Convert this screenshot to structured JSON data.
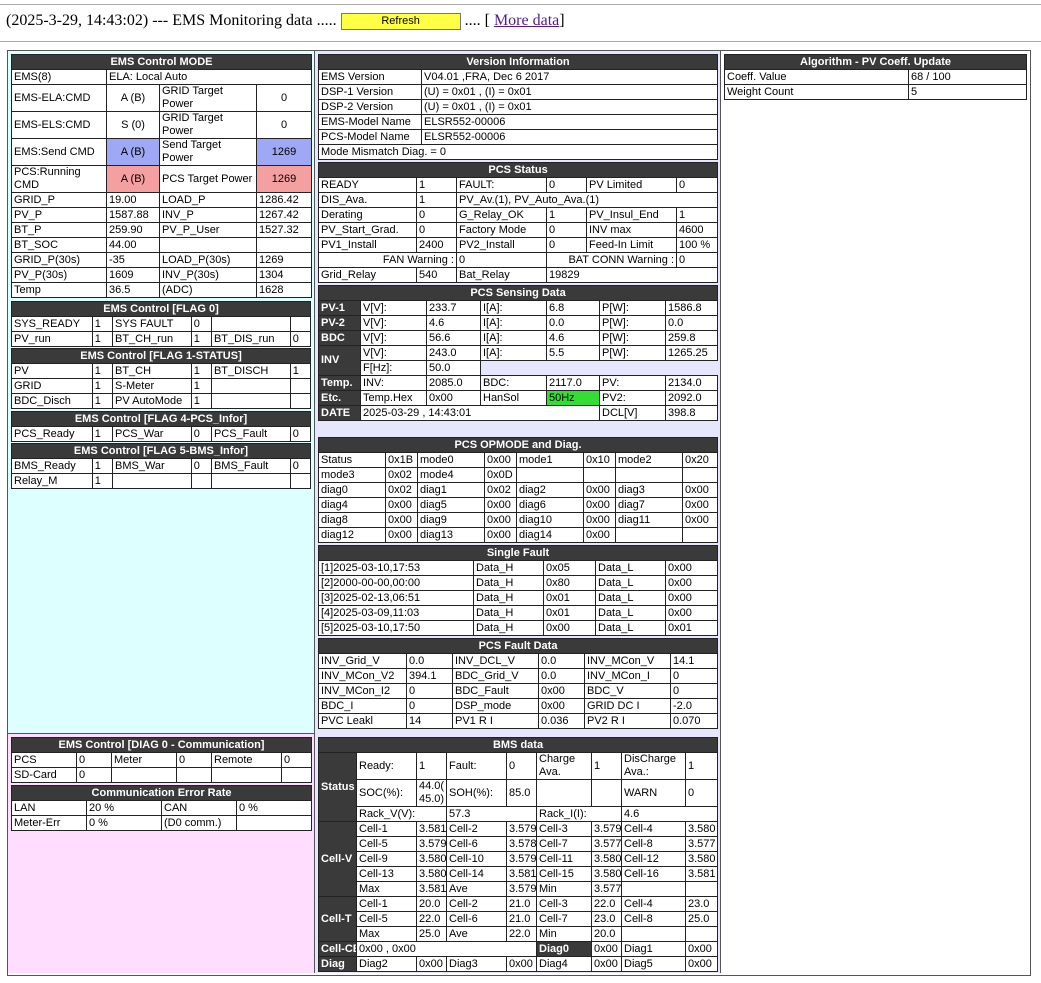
{
  "header": {
    "prefix": "(2025-3-29, 14:43:02) --- EMS Monitoring data .....",
    "refresh": "Refresh",
    "middle": ".... [",
    "more": "More data",
    "suffix": "]"
  },
  "ems_mode": {
    "title": "EMS Control MODE",
    "rows": [
      [
        "EMS(8)",
        "ELA: Local Auto"
      ],
      [
        "EMS-ELA:CMD",
        "A (B)",
        "GRID Target Power",
        "0"
      ],
      [
        "EMS-ELS:CMD",
        "S (0)",
        "GRID Target Power",
        "0"
      ],
      [
        "EMS:Send CMD",
        "A (B)",
        "Send Target Power",
        "1269"
      ],
      [
        "PCS:Running CMD",
        "A (B)",
        "PCS Target Power",
        "1269"
      ],
      [
        "GRID_P",
        "19.00",
        "LOAD_P",
        "1286.42"
      ],
      [
        "PV_P",
        "1587.88",
        "INV_P",
        "1267.42"
      ],
      [
        "BT_P",
        "259.90",
        "PV_P_User",
        "1527.32"
      ],
      [
        "BT_SOC",
        "44.00",
        "",
        ""
      ],
      [
        "GRID_P(30s)",
        "-35",
        "LOAD_P(30s)",
        "1269"
      ],
      [
        "PV_P(30s)",
        "1609",
        "INV_P(30s)",
        "1304"
      ],
      [
        "Temp",
        "36.5",
        "(ADC)",
        "1628"
      ]
    ]
  },
  "flag0": {
    "title": "EMS Control [FLAG 0]",
    "rows": [
      [
        "SYS_READY",
        "1",
        "SYS FAULT",
        "0",
        "",
        ""
      ],
      [
        "PV_run",
        "1",
        "BT_CH_run",
        "1",
        "BT_DIS_run",
        "0"
      ]
    ]
  },
  "flag1": {
    "title": "EMS Control [FLAG 1-STATUS]",
    "rows": [
      [
        "PV",
        "1",
        "BT_CH",
        "1",
        "BT_DISCH",
        "1"
      ],
      [
        "GRID",
        "1",
        "S-Meter",
        "1",
        "",
        ""
      ],
      [
        "BDC_Disch",
        "1",
        "PV AutoMode",
        "1",
        "",
        ""
      ]
    ]
  },
  "flag4": {
    "title": "EMS Control [FLAG 4-PCS_Infor]",
    "rows": [
      [
        "PCS_Ready",
        "1",
        "PCS_War",
        "0",
        "PCS_Fault",
        "0"
      ]
    ]
  },
  "flag5": {
    "title": "EMS Control [FLAG 5-BMS_Infor]",
    "rows": [
      [
        "BMS_Ready",
        "1",
        "BMS_War",
        "0",
        "BMS_Fault",
        "0"
      ],
      [
        "Relay_M",
        "1",
        "",
        "",
        "",
        ""
      ]
    ]
  },
  "diag0": {
    "title": "EMS Control [DIAG 0 - Communication]",
    "rows": [
      [
        "PCS",
        "0",
        "Meter",
        "0",
        "Remote",
        "0"
      ],
      [
        "SD-Card",
        "0",
        "",
        "",
        "",
        ""
      ]
    ]
  },
  "comm": {
    "title": "Communication Error Rate",
    "rows": [
      [
        "LAN",
        "20 %",
        "CAN",
        "0 %"
      ],
      [
        "Meter-Err",
        "0 %",
        "(D0 comm.)",
        ""
      ]
    ]
  },
  "version": {
    "title": "Version Information",
    "rows": [
      [
        "EMS Version",
        "V04.01 ,FRA, Dec 6 2017"
      ],
      [
        "DSP-1 Version",
        "(U) = 0x01 , (I) = 0x01"
      ],
      [
        "DSP-2 Version",
        "(U) = 0x01 , (I) = 0x01"
      ],
      [
        "EMS-Model Name",
        "ELSR552-00006"
      ],
      [
        "PCS-Model Name",
        "ELSR552-00006"
      ]
    ],
    "mismatch": "Mode Mismatch Diag. = 0"
  },
  "pcs_status": {
    "title": "PCS Status",
    "rows": [
      [
        "READY",
        "1",
        "FAULT:",
        "0",
        "PV Limited",
        "0"
      ],
      [
        "DIS_Ava.",
        "1",
        "PV_Av.(1), PV_Auto_Ava.(1)"
      ],
      [
        "Derating",
        "0",
        "G_Relay_OK",
        "1",
        "PV_Insul_End",
        "1"
      ],
      [
        "PV_Start_Grad.",
        "0",
        "Factory Mode",
        "0",
        "INV max",
        "4600"
      ],
      [
        "PV1_Install",
        "2400",
        "PV2_Install",
        "0",
        "Feed-In Limit",
        "100 %"
      ]
    ],
    "fan_label": "FAN Warning :",
    "fan_val": "0",
    "batconn_label": "BAT CONN Warning :",
    "batconn_val": "0",
    "last": [
      "Grid_Relay",
      "540",
      "Bat_Relay",
      "19829"
    ]
  },
  "pcs_sensing": {
    "title": "PCS Sensing Data",
    "rows": [
      [
        "PV-1",
        "V[V]:",
        "233.7",
        "I[A]:",
        "6.8",
        "P[W]:",
        "1586.8"
      ],
      [
        "PV-2",
        "V[V]:",
        "4.6",
        "I[A]:",
        "0.0",
        "P[W]:",
        "0.0"
      ],
      [
        "BDC",
        "V[V]:",
        "56.6",
        "I[A]:",
        "4.6",
        "P[W]:",
        "259.8"
      ]
    ],
    "inv_label": "INV",
    "inv_row": [
      "V[V]:",
      "243.0",
      "I[A]:",
      "5.5",
      "P[W]:",
      "1265.25"
    ],
    "inv_f": [
      "F[Hz]:",
      "50.0"
    ],
    "temp_label": "Temp.",
    "temp_row": [
      "INV:",
      "2085.0",
      "BDC:",
      "2117.0",
      "PV:",
      "2134.0"
    ],
    "etc_label": "Etc.",
    "etc_row": [
      "Temp.Hex",
      "0x00",
      "HanSol",
      "50Hz",
      "PV2:",
      "2092.0"
    ],
    "date_label": "DATE",
    "date_val": "2025-03-29 , 14:43:01",
    "dcl_label": "DCL[V]",
    "dcl_val": "398.8"
  },
  "opmode": {
    "title": "PCS OPMODE and Diag.",
    "rows": [
      [
        "Status",
        "0x1B",
        "mode0",
        "0x00",
        "mode1",
        "0x10",
        "mode2",
        "0x20"
      ],
      [
        "mode3",
        "0x02",
        "mode4",
        "0x0D",
        "",
        "",
        "",
        ""
      ],
      [
        "diag0",
        "0x02",
        "diag1",
        "0x02",
        "diag2",
        "0x00",
        "diag3",
        "0x00"
      ],
      [
        "diag4",
        "0x00",
        "diag5",
        "0x00",
        "diag6",
        "0x00",
        "diag7",
        "0x00"
      ],
      [
        "diag8",
        "0x00",
        "diag9",
        "0x00",
        "diag10",
        "0x00",
        "diag11",
        "0x00"
      ],
      [
        "diag12",
        "0x00",
        "diag13",
        "0x00",
        "diag14",
        "0x00",
        "",
        ""
      ]
    ]
  },
  "single_fault": {
    "title": "Single Fault",
    "rows": [
      [
        "[1]2025-03-10,17:53",
        "Data_H",
        "0x05",
        "Data_L",
        "0x00"
      ],
      [
        "[2]2000-00-00,00:00",
        "Data_H",
        "0x80",
        "Data_L",
        "0x00"
      ],
      [
        "[3]2025-02-13,06:51",
        "Data_H",
        "0x01",
        "Data_L",
        "0x00"
      ],
      [
        "[4]2025-03-09,11:03",
        "Data_H",
        "0x01",
        "Data_L",
        "0x00"
      ],
      [
        "[5]2025-03-10,17:50",
        "Data_H",
        "0x00",
        "Data_L",
        "0x01"
      ]
    ]
  },
  "pcs_fault": {
    "title": "PCS Fault Data",
    "rows": [
      [
        "INV_Grid_V",
        "0.0",
        "INV_DCL_V",
        "0.0",
        "INV_MCon_V",
        "14.1"
      ],
      [
        "INV_MCon_V2",
        "394.1",
        "BDC_Grid_V",
        "0.0",
        "INV_MCon_I",
        "0"
      ],
      [
        "INV_MCon_I2",
        "0",
        "BDC_Fault",
        "0x00",
        "BDC_V",
        "0"
      ],
      [
        "BDC_I",
        "0",
        "DSP_mode",
        "0x00",
        "GRID DC I",
        "-2.0"
      ],
      [
        "PVC Leakl",
        "14",
        "PV1 R I",
        "0.036",
        "PV2 R I",
        "0.070"
      ]
    ]
  },
  "bms": {
    "title": "BMS data",
    "status_label": "Status",
    "status1": [
      "Ready:",
      "1",
      "Fault:",
      "0",
      "Charge Ava.",
      "1",
      "DisCharge Ava.:",
      "1"
    ],
    "status2": [
      "SOC(%):",
      "44.0( 45.0)",
      "SOH(%):",
      "85.0",
      "",
      "",
      "WARN",
      "0"
    ],
    "rack": [
      "Rack_V(V):",
      "57.3",
      "Rack_I(I):",
      "4.6"
    ],
    "cellv_label": "Cell-V",
    "cellv": [
      [
        "Cell-1",
        "3.581",
        "Cell-2",
        "3.579",
        "Cell-3",
        "3.579",
        "Cell-4",
        "3.580"
      ],
      [
        "Cell-5",
        "3.579",
        "Cell-6",
        "3.578",
        "Cell-7",
        "3.577",
        "Cell-8",
        "3.577"
      ],
      [
        "Cell-9",
        "3.580",
        "Cell-10",
        "3.579",
        "Cell-11",
        "3.580",
        "Cell-12",
        "3.580"
      ],
      [
        "Cell-13",
        "3.580",
        "Cell-14",
        "3.581",
        "Cell-15",
        "3.580",
        "Cell-16",
        "3.581"
      ],
      [
        "Max",
        "3.581",
        "Ave",
        "3.579",
        "Min",
        "3.577",
        "",
        ""
      ]
    ],
    "cellt_label": "Cell-T",
    "cellt": [
      [
        "Cell-1",
        "20.0",
        "Cell-2",
        "21.0",
        "Cell-3",
        "22.0",
        "Cell-4",
        "23.0"
      ],
      [
        "Cell-5",
        "22.0",
        "Cell-6",
        "21.0",
        "Cell-7",
        "23.0",
        "Cell-8",
        "25.0"
      ],
      [
        "Max",
        "25.0",
        "Ave",
        "22.0",
        "Min",
        "20.0",
        "",
        ""
      ]
    ],
    "cellcb": [
      "Cell-CB",
      "0x00 , 0x00",
      "Diag0",
      "0x00",
      "Diag1",
      "0x00"
    ],
    "diag": [
      "Diag",
      "Diag2",
      "0x00",
      "Diag3",
      "0x00",
      "Diag4",
      "0x00",
      "Diag5",
      "0x00"
    ]
  },
  "algo": {
    "title": "Algorithm - PV Coeff. Update",
    "rows": [
      [
        "Coeff. Value",
        "68 / 100"
      ],
      [
        "Weight Count",
        "5"
      ]
    ]
  },
  "colors": {
    "cyan_panel": "#ddffff",
    "lavender_panel": "#e6e6ff",
    "pink_panel": "#ffddff",
    "header_dark": "#3a3a3a",
    "refresh_yellow": "#ffff44",
    "cmd_blue": "#9fa8f5",
    "cmd_pink": "#f5a0a0",
    "hz_green": "#33dd33"
  }
}
